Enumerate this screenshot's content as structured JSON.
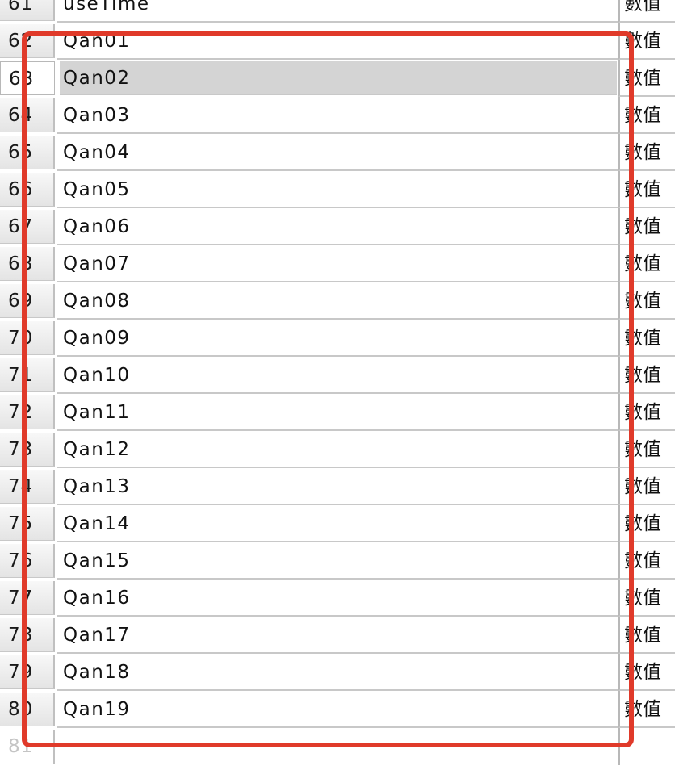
{
  "rows": [
    {
      "num": "61",
      "name": "useTime",
      "type": "數值"
    },
    {
      "num": "62",
      "name": "Qan01",
      "type": "數值"
    },
    {
      "num": "63",
      "name": "Qan02",
      "type": "數值",
      "selected": true
    },
    {
      "num": "64",
      "name": "Qan03",
      "type": "數值"
    },
    {
      "num": "65",
      "name": "Qan04",
      "type": "數值"
    },
    {
      "num": "66",
      "name": "Qan05",
      "type": "數值"
    },
    {
      "num": "67",
      "name": "Qan06",
      "type": "數值"
    },
    {
      "num": "68",
      "name": "Qan07",
      "type": "數值"
    },
    {
      "num": "69",
      "name": "Qan08",
      "type": "數值"
    },
    {
      "num": "70",
      "name": "Qan09",
      "type": "數值"
    },
    {
      "num": "71",
      "name": "Qan10",
      "type": "數值"
    },
    {
      "num": "72",
      "name": "Qan11",
      "type": "數值"
    },
    {
      "num": "73",
      "name": "Qan12",
      "type": "數值"
    },
    {
      "num": "74",
      "name": "Qan13",
      "type": "數值"
    },
    {
      "num": "75",
      "name": "Qan14",
      "type": "數值"
    },
    {
      "num": "76",
      "name": "Qan15",
      "type": "數值"
    },
    {
      "num": "77",
      "name": "Qan16",
      "type": "數值"
    },
    {
      "num": "78",
      "name": "Qan17",
      "type": "數值"
    },
    {
      "num": "79",
      "name": "Qan18",
      "type": "數值"
    },
    {
      "num": "80",
      "name": "Qan19",
      "type": "數值"
    },
    {
      "num": "81",
      "name": "",
      "type": "",
      "empty": true
    }
  ],
  "colors": {
    "highlight_border": "#e03a2a",
    "selected_row_fill": "#d4d4d4",
    "empty_row_number": "#c4c4c4"
  }
}
